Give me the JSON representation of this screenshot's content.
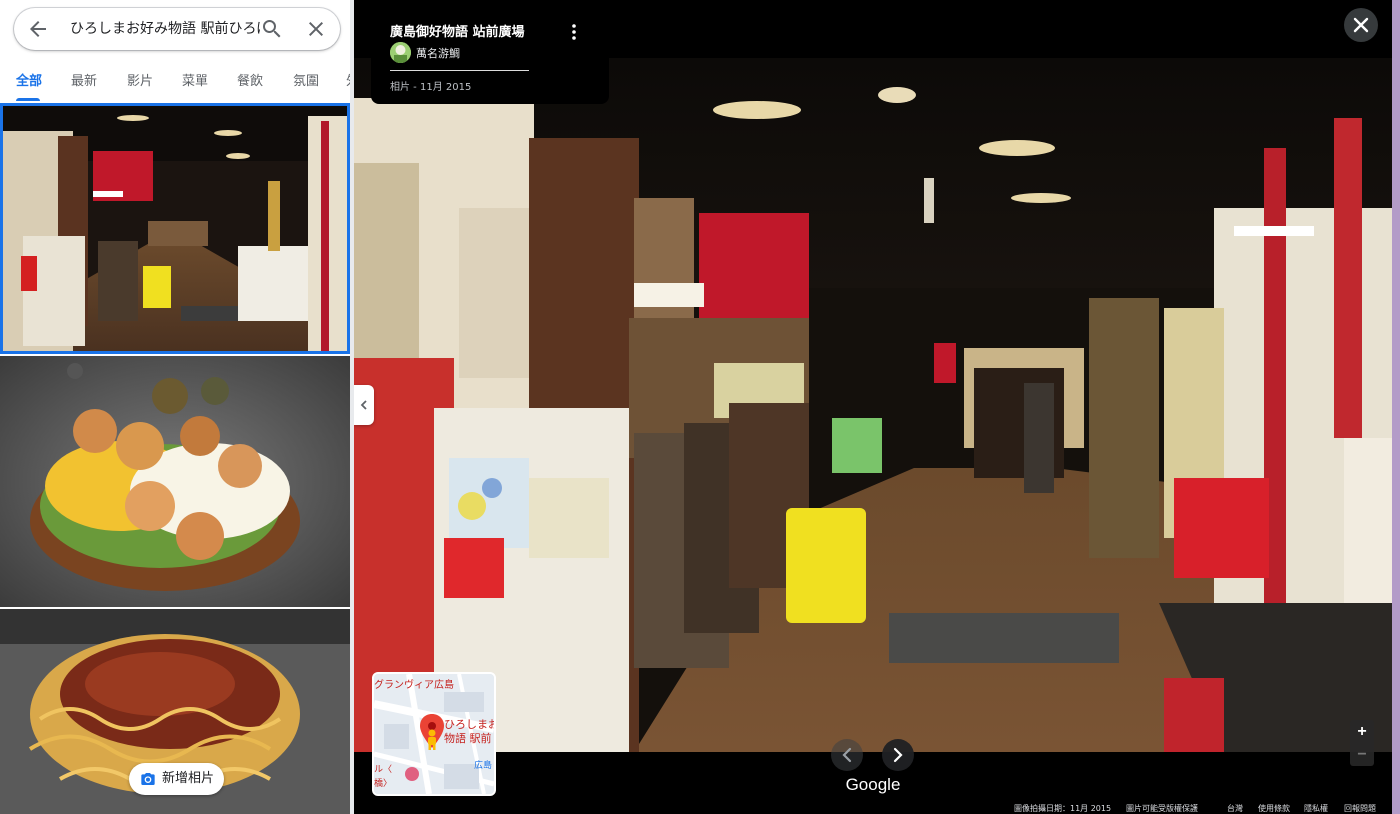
{
  "search": {
    "value": "ひろしまお好み物語 駅前ひろば",
    "back_icon": "arrow-back-icon",
    "search_icon": "search-icon",
    "clear_icon": "close-icon"
  },
  "tabs": [
    {
      "label": "全部",
      "active": true
    },
    {
      "label": "最新"
    },
    {
      "label": "影片"
    },
    {
      "label": "菜單"
    },
    {
      "label": "餐飲"
    },
    {
      "label": "氛圍"
    },
    {
      "label": "外"
    }
  ],
  "add_photo": {
    "label": "新增相片",
    "icon": "camera-icon"
  },
  "photo_info": {
    "title": "廣島御好物語 站前廣場",
    "contributor": "萬名游鯛",
    "date": "相片 - 11月 2015",
    "menu_icon": "more-vert-icon"
  },
  "viewer": {
    "close_icon": "close-icon",
    "collapse_icon": "chevron-left-icon",
    "prev_icon": "chevron-left-icon",
    "next_icon": "chevron-right-icon",
    "google_label": "Google",
    "zoom_in": "+",
    "zoom_out": "−"
  },
  "minimap": {
    "label_top": "グランヴィア広島",
    "label_place_1": "ひろしまお",
    "label_place_2": "物語 駅前",
    "label_station": "広島",
    "label_left": "ル〈",
    "label_bridge": "橋〉",
    "pin_icon": "map-pin-icon",
    "pegman_icon": "pegman-icon"
  },
  "footer": {
    "capture_date": "圖像拍攝日期：11月 2015",
    "copyright": "圖片可能受版權保護",
    "region": "台灣",
    "terms": "使用條款",
    "privacy": "隱私權",
    "report": "回報問題"
  },
  "colors": {
    "accent": "#1a73e8",
    "noren_red": "#c0182a",
    "luggage_yellow": "#f0e020"
  }
}
